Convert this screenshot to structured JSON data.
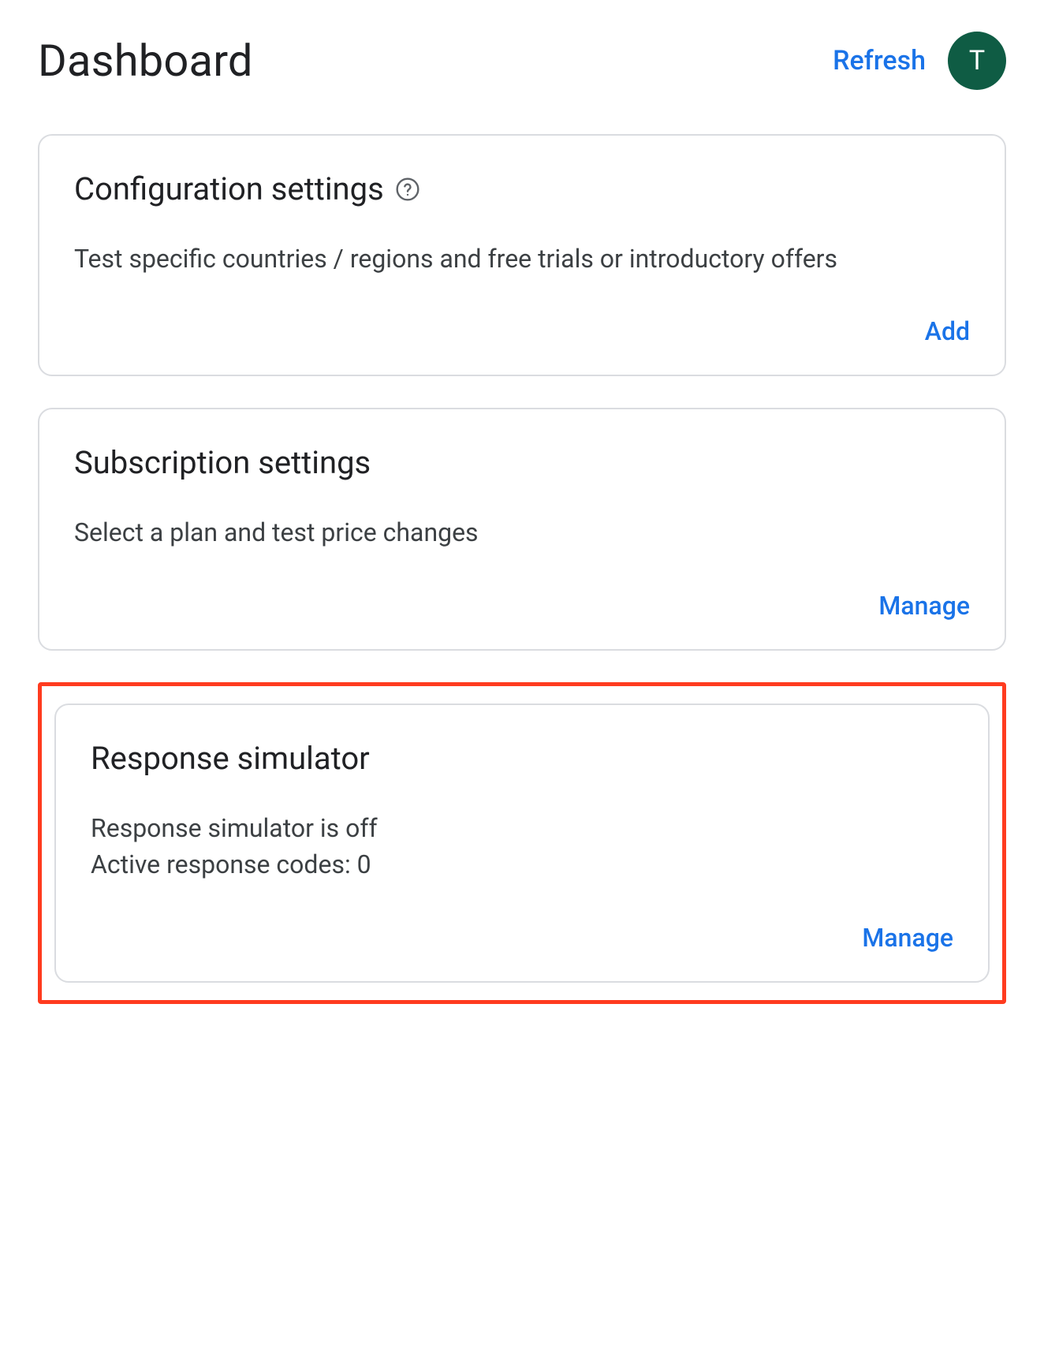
{
  "header": {
    "title": "Dashboard",
    "refresh_label": "Refresh",
    "avatar_initial": "T"
  },
  "cards": {
    "config": {
      "title": "Configuration settings",
      "description": "Test specific countries / regions and free trials or introductory offers",
      "action": "Add"
    },
    "subscription": {
      "title": "Subscription settings",
      "description": "Select a plan and test price changes",
      "action": "Manage"
    },
    "simulator": {
      "title": "Response simulator",
      "status_line": "Response simulator is off",
      "codes_line": "Active response codes: 0",
      "action": "Manage"
    }
  }
}
